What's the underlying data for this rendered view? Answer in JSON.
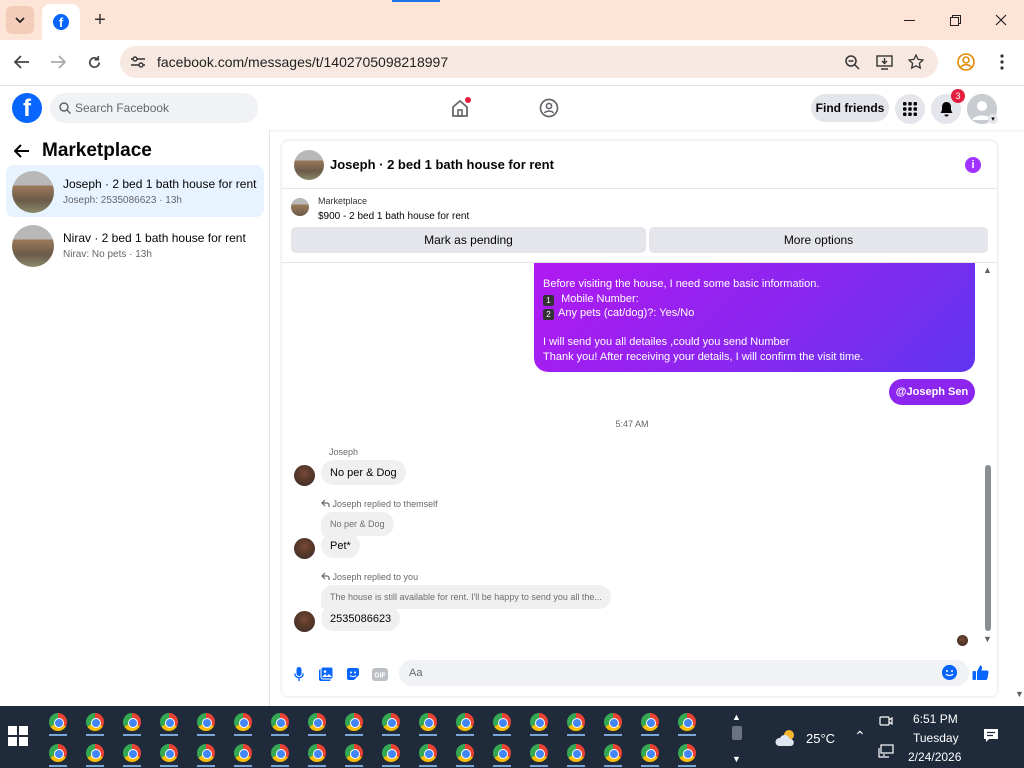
{
  "browser": {
    "url": "facebook.com/messages/t/1402705098218997",
    "new_tab_label": "+"
  },
  "facebook": {
    "search_placeholder": "Search Facebook",
    "find_friends": "Find friends",
    "notification_count": "3"
  },
  "sidebar": {
    "title": "Marketplace",
    "conversations": [
      {
        "title": "Joseph · 2 bed 1 bath house for rent",
        "snippet": "Joseph: 2535086623 · 13h",
        "active": true
      },
      {
        "title": "Nirav · 2 bed 1 bath house for rent",
        "snippet": "Nirav: No pets · 13h",
        "active": false
      }
    ]
  },
  "chat": {
    "title": "Joseph · 2 bed 1 bath house for rent",
    "marketplace_label": "Marketplace",
    "listing": "$900 - 2 bed 1 bath house for rent",
    "mark_pending": "Mark as pending",
    "more_options": "More options",
    "outgoing_lines": [
      "Before visiting the house, I need some basic information.",
      "Mobile Number:",
      "Any pets (cat/dog)?: Yes/No",
      "",
      "I will send you all detailes ,could you send Number",
      "Thank you! After receiving your details, I will confirm the visit time."
    ],
    "keycap_1": "1",
    "keycap_2": "2",
    "mention": "@Joseph Sen",
    "timestamp": "5:47 AM",
    "sender_name": "Joseph",
    "msg1": "No per & Dog",
    "reply1_label": "Joseph replied to themself",
    "reply1_quote": "No per & Dog",
    "msg2": "Pet*",
    "reply2_label": "Joseph replied to you",
    "reply2_quote": "The house is still available for rent. I'll be happy to send you all the...",
    "msg3": "2535086623",
    "composer_placeholder": "Aa"
  },
  "taskbar": {
    "temperature": "25°C",
    "time": "6:51 PM",
    "day": "Tuesday",
    "date": "2/24/2026"
  }
}
